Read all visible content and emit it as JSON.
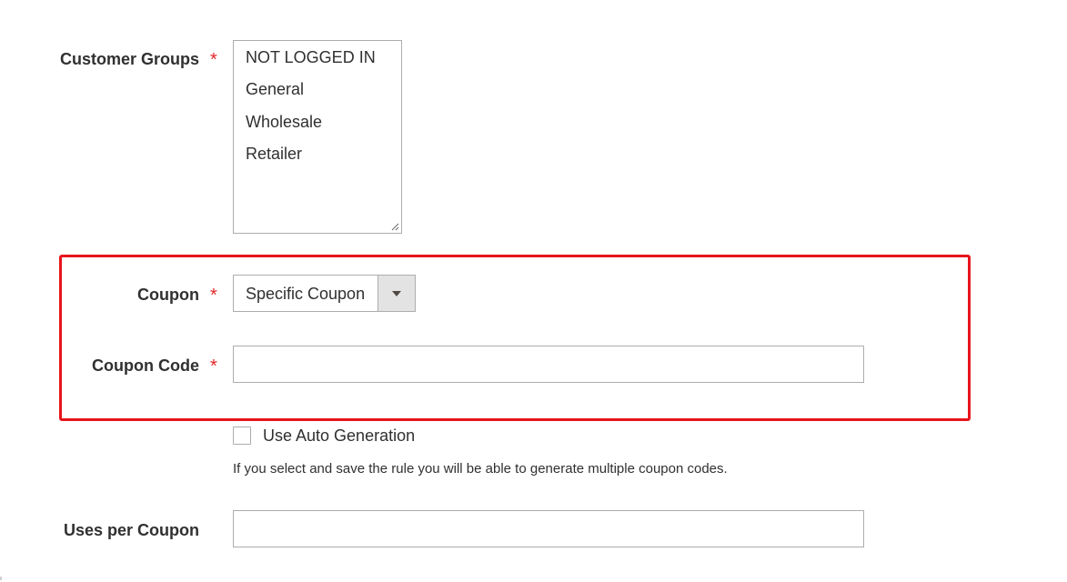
{
  "customer_groups": {
    "label": "Customer Groups",
    "required_mark": "*",
    "options": [
      "NOT LOGGED IN",
      "General",
      "Wholesale",
      "Retailer"
    ]
  },
  "coupon": {
    "label": "Coupon",
    "required_mark": "*",
    "selected_value": "Specific Coupon"
  },
  "coupon_code": {
    "label": "Coupon Code",
    "required_mark": "*",
    "value": ""
  },
  "auto_generation": {
    "label": "Use Auto Generation",
    "checked": false,
    "note": "If you select and save the rule you will be able to generate multiple coupon codes."
  },
  "uses_per_coupon": {
    "label": "Uses per Coupon",
    "value": ""
  },
  "colors": {
    "required": "#e22626",
    "highlight": "#e8141c",
    "border": "#adadad",
    "select_button": "#e3e3e3"
  }
}
